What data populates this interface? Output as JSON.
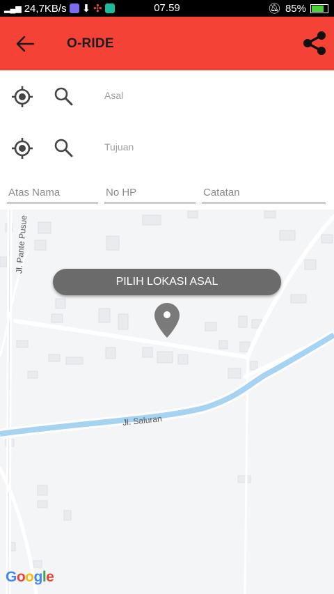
{
  "status_bar": {
    "network_speed": "24,7KB/s",
    "time": "07.59",
    "battery": "85%"
  },
  "app_bar": {
    "title": "O-RIDE",
    "color": "#f44336"
  },
  "form": {
    "origin_placeholder": "Asal",
    "destination_placeholder": "Tujuan",
    "name_placeholder": "Atas Nama",
    "phone_placeholder": "No HP",
    "notes_placeholder": "Catatan"
  },
  "map": {
    "pick_button": "PILIH LOKASI ASAL",
    "road_1": "Jl. Pante Pusue",
    "road_2": "Jl. Saluran",
    "attribution": "Google"
  },
  "icons": [
    "back-arrow-icon",
    "share-icon",
    "gps-target-icon",
    "search-icon",
    "map-pin-icon"
  ]
}
